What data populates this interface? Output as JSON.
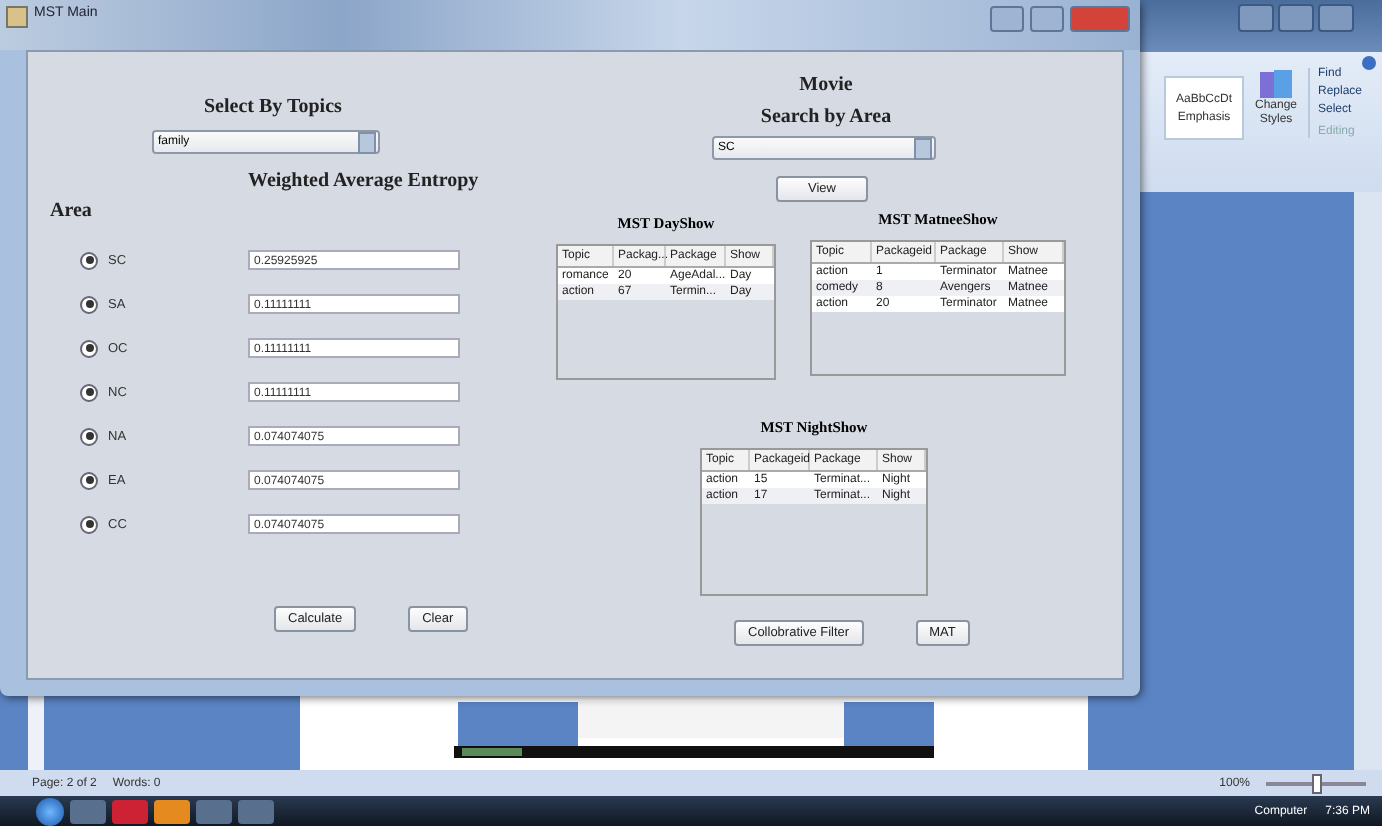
{
  "window": {
    "title": "MST Main"
  },
  "topics": {
    "heading": "Select By Topics",
    "value": "family"
  },
  "entropy_heading": "Weighted Average Entropy",
  "area_heading": "Area",
  "areas": [
    {
      "label": "SC",
      "checked": true,
      "value": "0.25925925"
    },
    {
      "label": "SA",
      "checked": true,
      "value": "0.11111111"
    },
    {
      "label": "OC",
      "checked": true,
      "value": "0.11111111"
    },
    {
      "label": "NC",
      "checked": true,
      "value": "0.11111111"
    },
    {
      "label": "NA",
      "checked": true,
      "value": "0.074074075"
    },
    {
      "label": "EA",
      "checked": true,
      "value": "0.074074075"
    },
    {
      "label": "CC",
      "checked": true,
      "value": "0.074074075"
    }
  ],
  "left_buttons": [
    "Calculate",
    "Clear"
  ],
  "movie_heading": "Movie",
  "search": {
    "heading": "Search by Area",
    "value": "SC"
  },
  "view_button": "View",
  "tables": [
    {
      "title": "MST DayShow",
      "columns": [
        "Topic",
        "Packag...",
        "Package",
        "Show"
      ],
      "rows": [
        [
          "romance",
          "20",
          "AgeAdal...",
          "Day"
        ],
        [
          "action",
          "67",
          "Termin...",
          "Day"
        ]
      ]
    },
    {
      "title": "MST MatneeShow",
      "columns": [
        "Topic",
        "Packageid",
        "Package",
        "Show"
      ],
      "rows": [
        [
          "action",
          "1",
          "Terminator",
          "Matnee"
        ],
        [
          "comedy",
          "8",
          "Avengers",
          "Matnee"
        ],
        [
          "action",
          "20",
          "Terminator",
          "Matnee"
        ]
      ]
    },
    {
      "title": "MST NightShow",
      "columns": [
        "Topic",
        "Packageid",
        "Package",
        "Show"
      ],
      "rows": [
        [
          "action",
          "15",
          "Terminat...",
          "Night"
        ],
        [
          "action",
          "17",
          "Terminat...",
          "Night"
        ]
      ]
    }
  ],
  "right_buttons": [
    "Collobrative Filter",
    "MAT"
  ],
  "ribbon": {
    "style_sample": "AaBbCcDt",
    "style_name": "Emphasis",
    "change_styles": "Change Styles",
    "editing": [
      "Find",
      "Replace",
      "Select"
    ],
    "group_label": "Editing"
  },
  "status_bar": {
    "page": "Page: 2 of 2",
    "words": "Words: 0",
    "zoom": "100%",
    "zoom_slider": {
      "level": 0.5
    }
  },
  "taskbar": {
    "location": "Computer",
    "time": "7:36 PM"
  }
}
